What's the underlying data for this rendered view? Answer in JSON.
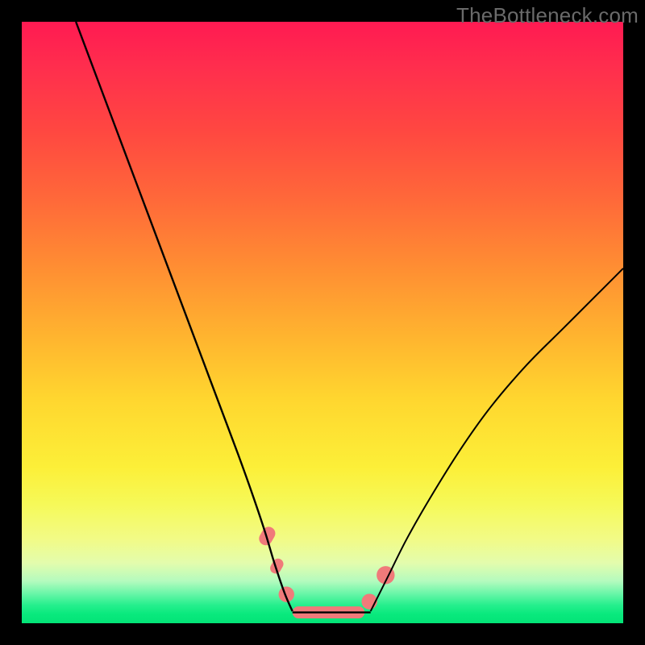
{
  "watermark": "TheBottleneck.com",
  "chart_data": {
    "type": "line",
    "title": "",
    "xlabel": "",
    "ylabel": "",
    "xlim": [
      0,
      100
    ],
    "ylim": [
      0,
      100
    ],
    "grid": false,
    "legend": false,
    "background_gradient_stops": [
      {
        "pos": 0,
        "color": "#ff1a52"
      },
      {
        "pos": 18,
        "color": "#ff4741"
      },
      {
        "pos": 40,
        "color": "#ff8b33"
      },
      {
        "pos": 63,
        "color": "#ffd72f"
      },
      {
        "pos": 80,
        "color": "#f6f957"
      },
      {
        "pos": 93,
        "color": "#b4fbbe"
      },
      {
        "pos": 100,
        "color": "#03e477"
      }
    ],
    "series": [
      {
        "name": "left-curve",
        "stroke": "#000000",
        "x": [
          9.0,
          12,
          15,
          18,
          21,
          24,
          27,
          30,
          33,
          36,
          38.5,
          40.5,
          42,
          43.7,
          45
        ],
        "y_pct": [
          100,
          92,
          84,
          76,
          68,
          60,
          52,
          44,
          36,
          28,
          21,
          15,
          10,
          5,
          2
        ]
      },
      {
        "name": "right-curve",
        "stroke": "#000000",
        "x": [
          58,
          59.5,
          61,
          64,
          68,
          73,
          78,
          84,
          90,
          96,
          100
        ],
        "y_pct": [
          2,
          5,
          8,
          14,
          21,
          29,
          36,
          43,
          49,
          55,
          59
        ]
      }
    ],
    "flat_bottom": {
      "x_start": 45,
      "x_end": 58,
      "y_pct": 1.8
    },
    "markers": [
      {
        "x": 40.8,
        "y_pct": 14.5,
        "color": "#f07a7a",
        "shape": "pill",
        "w": 3.2,
        "h": 2.2,
        "angle": -60
      },
      {
        "x": 42.4,
        "y_pct": 9.5,
        "color": "#f07a7a",
        "shape": "pill",
        "w": 2.6,
        "h": 1.8,
        "angle": -60
      },
      {
        "x": 44.0,
        "y_pct": 4.8,
        "color": "#f07a7a",
        "shape": "dot",
        "r": 1.3
      },
      {
        "x": 51.0,
        "y_pct": 1.8,
        "color": "#f07a7a",
        "shape": "pill",
        "w": 12.0,
        "h": 2.0,
        "angle": 0
      },
      {
        "x": 57.8,
        "y_pct": 3.6,
        "color": "#f07a7a",
        "shape": "dot",
        "r": 1.3
      },
      {
        "x": 60.5,
        "y_pct": 8.0,
        "color": "#f07a7a",
        "shape": "dot",
        "r": 1.5
      }
    ]
  }
}
